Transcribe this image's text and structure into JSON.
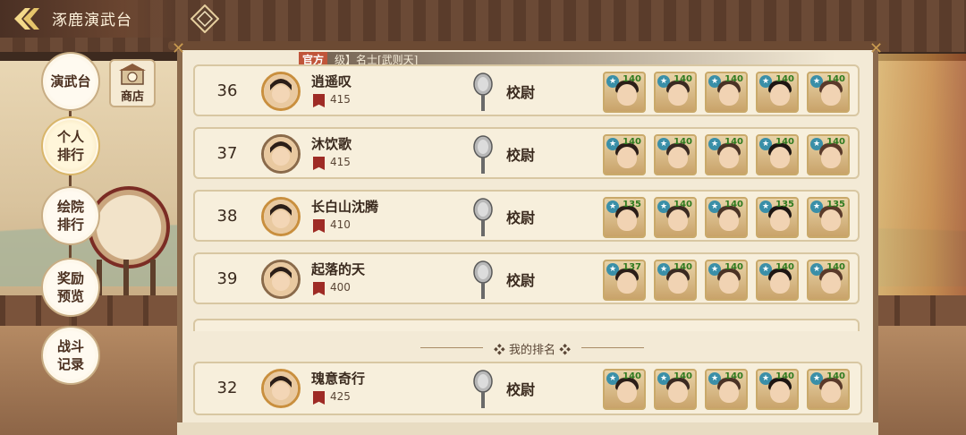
{
  "header": {
    "title": "涿鹿演武台"
  },
  "nav": {
    "shop_label": "商店",
    "items": [
      {
        "label": "演武台"
      },
      {
        "label": "个人\n排行"
      },
      {
        "label": "绘院\n排行"
      },
      {
        "label": "奖励\n预览"
      },
      {
        "label": "战斗\n记录"
      }
    ]
  },
  "notice": {
    "tag": "官方",
    "text": "级】名士[武则天]"
  },
  "rankings": [
    {
      "rank": "36",
      "name": "逍遥叹",
      "score": "415",
      "title": "校尉",
      "levels": [
        "140",
        "140",
        "140",
        "140",
        "140"
      ]
    },
    {
      "rank": "37",
      "name": "沐饮歌",
      "score": "415",
      "title": "校尉",
      "levels": [
        "140",
        "140",
        "140",
        "140",
        "140"
      ]
    },
    {
      "rank": "38",
      "name": "长白山沈腾",
      "score": "410",
      "title": "校尉",
      "levels": [
        "135",
        "140",
        "140",
        "135",
        "135"
      ]
    },
    {
      "rank": "39",
      "name": "起落的天",
      "score": "400",
      "title": "校尉",
      "levels": [
        "137",
        "140",
        "140",
        "140",
        "140"
      ]
    }
  ],
  "my_rank_label": "我的排名",
  "my_rank": {
    "rank": "32",
    "name": "瑰意奇行",
    "score": "425",
    "title": "校尉",
    "levels": [
      "140",
      "140",
      "140",
      "140",
      "140"
    ]
  },
  "colors": {
    "accent": "#c98f3e",
    "flag": "#9e2b25",
    "level_text": "#2f7a1f",
    "panel": "#f3ead6"
  }
}
